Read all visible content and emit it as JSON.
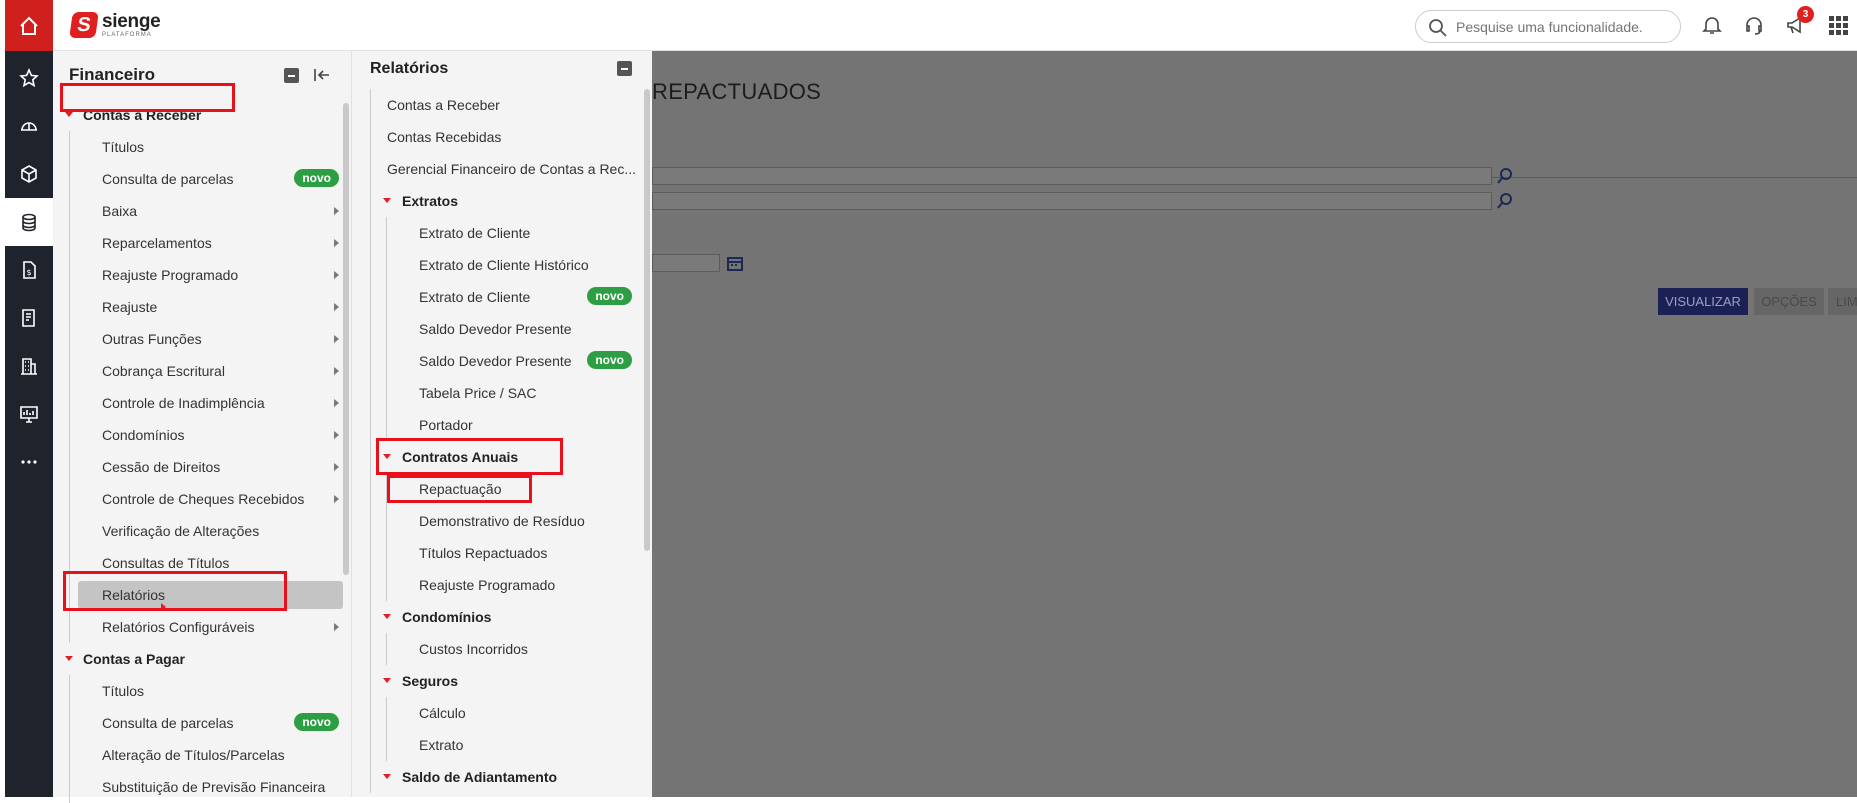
{
  "topbar": {
    "logo_name": "sienge",
    "logo_sub": "PLATAFORMA",
    "search_placeholder": "Pesquise uma funcionalidade.",
    "notifications_badge": "3"
  },
  "rail": {
    "items": [
      "home-icon",
      "star-icon",
      "helmet-icon",
      "box-icon",
      "coins-icon",
      "document-icon",
      "report-icon",
      "building-icon",
      "monitor-icon",
      "more-icon"
    ]
  },
  "financeiro": {
    "title": "Financeiro",
    "contas_receber": "Contas a Receber",
    "items": [
      {
        "label": "Títulos"
      },
      {
        "label": "Consulta de parcelas",
        "badge": "novo"
      },
      {
        "label": "Baixa"
      },
      {
        "label": "Reparcelamentos"
      },
      {
        "label": "Reajuste Programado"
      },
      {
        "label": "Reajuste"
      },
      {
        "label": "Outras Funções"
      },
      {
        "label": "Cobrança Escritural"
      },
      {
        "label": "Controle de Inadimplência"
      },
      {
        "label": "Condomínios"
      },
      {
        "label": "Cessão de Direitos"
      },
      {
        "label": "Controle de Cheques Recebidos"
      },
      {
        "label": "Verificação de Alterações"
      },
      {
        "label": "Consultas de Títulos"
      },
      {
        "label": "Relatórios"
      },
      {
        "label": "Relatórios Configuráveis"
      }
    ],
    "contas_pagar": "Contas a Pagar",
    "pagar_items": [
      {
        "label": "Títulos"
      },
      {
        "label": "Consulta de parcelas",
        "badge": "novo"
      },
      {
        "label": "Alteração de Títulos/Parcelas"
      },
      {
        "label": "Substituição de Previsão Financeira"
      }
    ]
  },
  "relatorios": {
    "title": "Relatórios",
    "top_items": [
      "Contas a Receber",
      "Contas Recebidas",
      "Gerencial Financeiro de Contas a Rec..."
    ],
    "extratos": "Extratos",
    "extratos_items": [
      {
        "label": "Extrato de Cliente"
      },
      {
        "label": "Extrato de Cliente Histórico"
      },
      {
        "label": "Extrato de Cliente",
        "badge": "novo"
      },
      {
        "label": "Saldo Devedor Presente"
      },
      {
        "label": "Saldo Devedor Presente",
        "badge": "novo"
      },
      {
        "label": "Tabela Price / SAC"
      },
      {
        "label": "Portador"
      }
    ],
    "contratos": "Contratos Anuais",
    "contratos_items": [
      "Repactuação",
      "Demonstrativo de Resíduo",
      "Títulos Repactuados",
      "Reajuste Programado"
    ],
    "condominios": "Condomínios",
    "condominios_items": [
      "Custos Incorridos"
    ],
    "seguros": "Seguros",
    "seguros_items": [
      "Cálculo",
      "Extrato"
    ],
    "saldo": "Saldo de Adiantamento"
  },
  "background": {
    "title": "REPACTUADOS",
    "btn_visualizar": "VISUALIZAR",
    "btn_opcoes": "OPÇÕES",
    "btn_limpar": "LIMP"
  },
  "colors": {
    "brand_red": "#e0201f",
    "rail_bg": "#1f242c",
    "novo_green": "#2e9e44",
    "highlight_red": "#e8101b"
  }
}
